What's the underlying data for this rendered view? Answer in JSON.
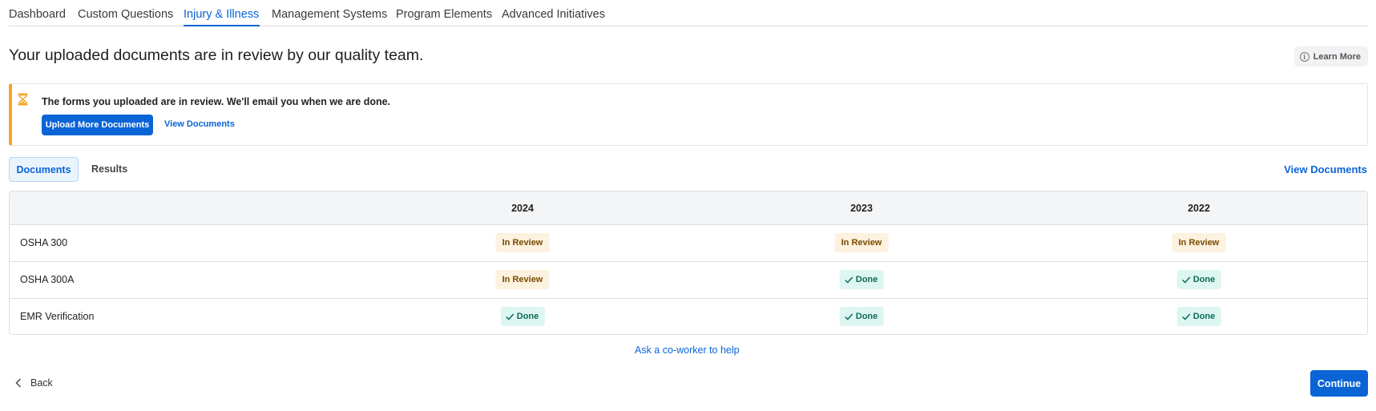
{
  "nav": {
    "tabs": [
      {
        "label": "Dashboard"
      },
      {
        "label": "Custom Questions"
      },
      {
        "label": "Injury & Illness"
      },
      {
        "label": "Management Systems"
      },
      {
        "label": "Program Elements"
      },
      {
        "label": "Advanced Initiatives"
      }
    ],
    "active_tab": "Injury & Illness"
  },
  "header": {
    "title": "Your uploaded documents are in review by our quality team.",
    "learn_more_label": "Learn More"
  },
  "alert": {
    "icon": "hourglass-icon",
    "message": "The forms you uploaded are in review. We'll email you when we are done.",
    "upload_button_label": "Upload More Documents",
    "view_documents_label": "View Documents",
    "accent_color": "#f5a623"
  },
  "subtabs": {
    "items": [
      {
        "label": "Documents"
      },
      {
        "label": "Results"
      }
    ],
    "active": "Documents",
    "view_documents_label": "View Documents"
  },
  "table": {
    "columns": [
      "",
      "2024",
      "2023",
      "2022"
    ],
    "rows": [
      {
        "label": "OSHA 300",
        "cells": [
          "In Review",
          "In Review",
          "In Review"
        ]
      },
      {
        "label": "OSHA 300A",
        "cells": [
          "In Review",
          "Done",
          "Done"
        ]
      },
      {
        "label": "EMR Verification",
        "cells": [
          "Done",
          "Done",
          "Done"
        ]
      }
    ]
  },
  "footer": {
    "help_link": "Ask a co-worker to help",
    "back_label": "Back",
    "continue_label": "Continue"
  },
  "colors": {
    "primary": "#0a64d6",
    "review_bg": "#fdf1df",
    "review_text": "#7a4c00",
    "done_bg": "#def6f1",
    "done_text": "#0c6b59"
  }
}
